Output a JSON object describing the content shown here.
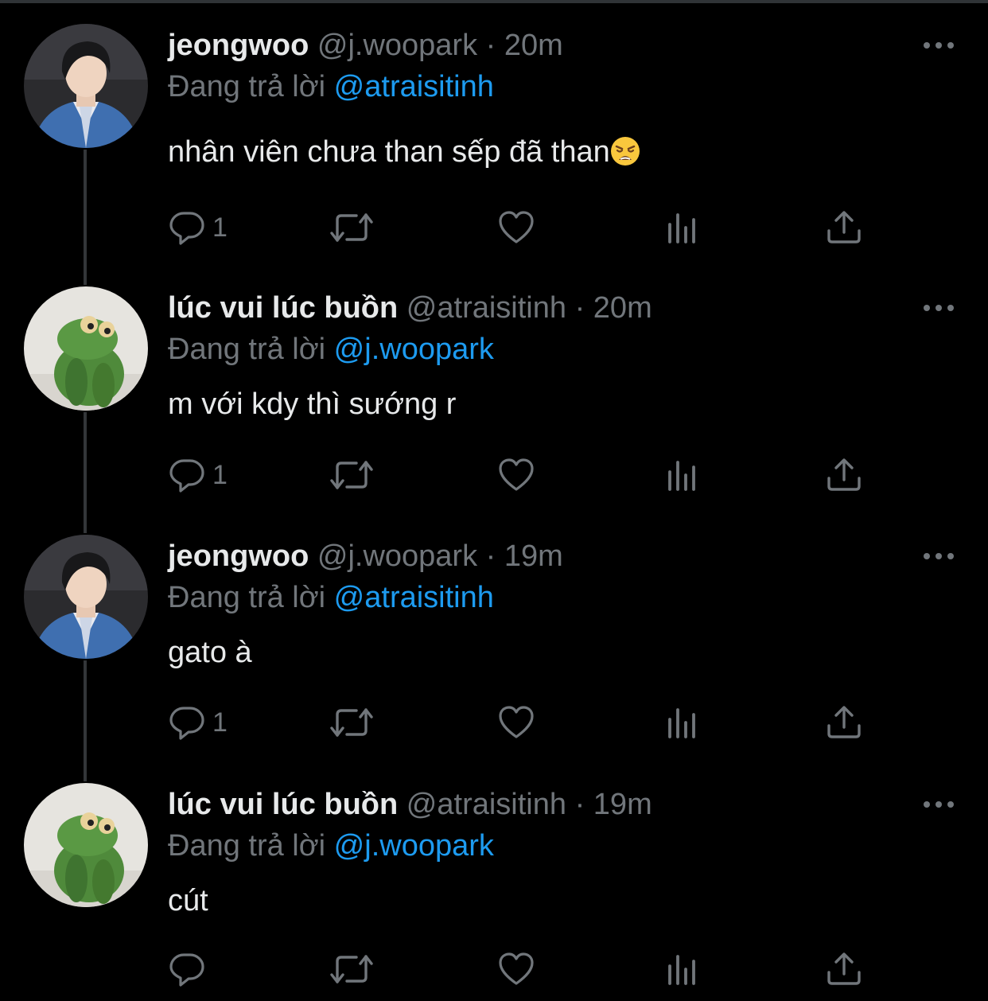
{
  "colors": {
    "background": "#000000",
    "text": "#e7e9ea",
    "muted": "#71767b",
    "accent": "#1d9bf0",
    "thread_line": "#333639"
  },
  "replying_label": "Đang trả lời",
  "tweets": [
    {
      "name": "jeongwoo",
      "handle": "@j.woopark",
      "separator": "·",
      "time": "20m",
      "replying_to": "@atraisitinh",
      "text": "nhân viên chưa than sếp đã than",
      "emoji": "weary-face",
      "avatar": "person-avatar",
      "reply_count": "1"
    },
    {
      "name": "lúc vui lúc buồn",
      "handle": "@atraisitinh",
      "separator": "·",
      "time": "20m",
      "replying_to": "@j.woopark",
      "text": "m với kdy thì sướng r",
      "avatar": "frog-avatar",
      "reply_count": "1"
    },
    {
      "name": "jeongwoo",
      "handle": "@j.woopark",
      "separator": "·",
      "time": "19m",
      "replying_to": "@atraisitinh",
      "text": "gato à",
      "avatar": "person-avatar",
      "reply_count": "1"
    },
    {
      "name": "lúc vui lúc buồn",
      "handle": "@atraisitinh",
      "separator": "·",
      "time": "19m",
      "replying_to": "@j.woopark",
      "text": "cút",
      "avatar": "frog-avatar",
      "reply_count": ""
    }
  ]
}
